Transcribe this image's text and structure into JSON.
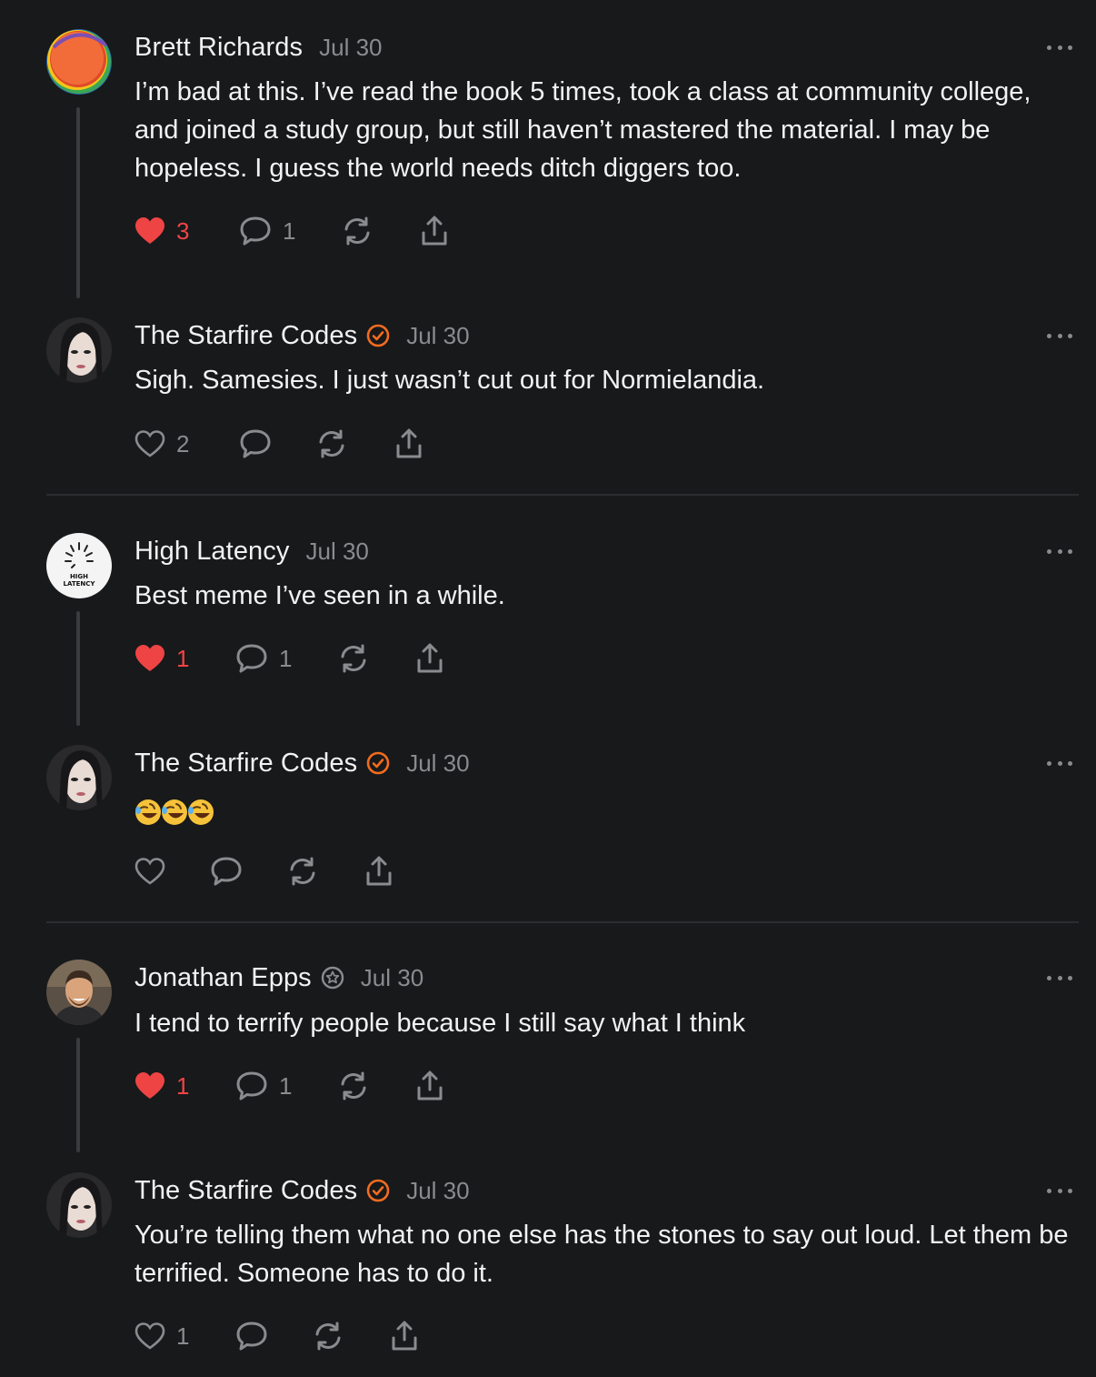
{
  "colors": {
    "background": "#18191b",
    "liked": "#ef4444",
    "verified": "#f26c1f",
    "muted": "#8a8b8e"
  },
  "comments": [
    {
      "author": "Brett Richards",
      "date": "Jul 30",
      "badge": "none",
      "avatar": "orange-swirl-avatar",
      "text": "I’m bad at this. I’ve read the book 5 times, took a class at community college, and joined a study group, but still haven’t mastered the material. I may be hopeless. I guess the world needs ditch diggers too.",
      "likes": "3",
      "liked": true,
      "replies": "1"
    },
    {
      "author": "The Starfire Codes",
      "date": "Jul 30",
      "badge": "verified-check",
      "avatar": "woman-portrait-avatar",
      "text": "Sigh. Samesies. I just wasn’t cut out for Normielandia.",
      "likes": "2",
      "liked": false,
      "replies": ""
    },
    {
      "author": "High Latency",
      "date": "Jul 30",
      "badge": "none",
      "avatar": "high-latency-logo-avatar",
      "avatar_text": [
        "HIGH",
        "LATENCY"
      ],
      "text": "Best meme I’ve seen in a while.",
      "likes": "1",
      "liked": true,
      "replies": "1"
    },
    {
      "author": "The Starfire Codes",
      "date": "Jul 30",
      "badge": "verified-check",
      "avatar": "woman-portrait-avatar",
      "text": "",
      "emoji": "rolling-on-floor-laughing x3",
      "likes": "",
      "liked": false,
      "replies": ""
    },
    {
      "author": "Jonathan Epps",
      "date": "Jul 30",
      "badge": "star-badge",
      "avatar": "man-portrait-avatar",
      "text": "I tend to terrify people because I still say what I think",
      "likes": "1",
      "liked": true,
      "replies": "1"
    },
    {
      "author": "The Starfire Codes",
      "date": "Jul 30",
      "badge": "verified-check",
      "avatar": "woman-portrait-avatar",
      "text": "You’re telling them what no one else has the stones to say out loud. Let them be terrified. Someone has to do it.",
      "likes": "1",
      "liked": false,
      "replies": ""
    }
  ]
}
